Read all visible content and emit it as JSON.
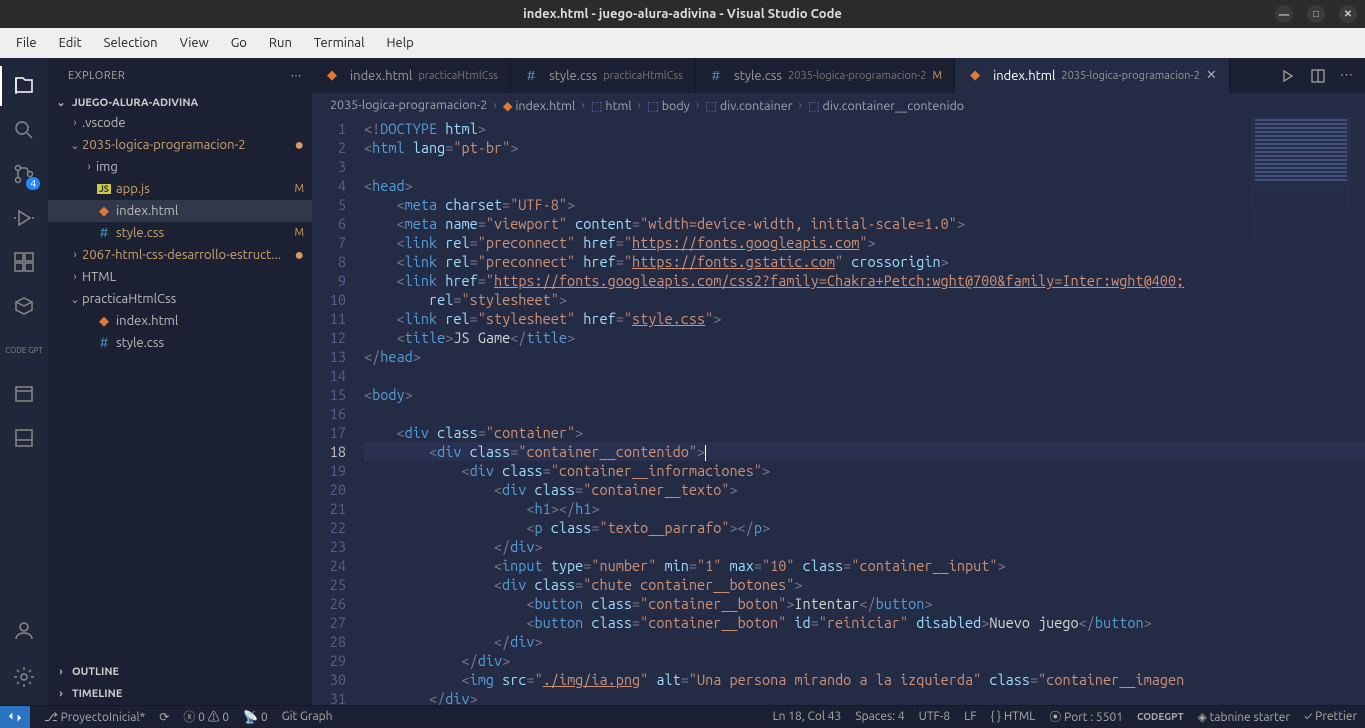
{
  "window": {
    "title": "index.html - juego-alura-adivina - Visual Studio Code"
  },
  "menubar": [
    "File",
    "Edit",
    "Selection",
    "View",
    "Go",
    "Run",
    "Terminal",
    "Help"
  ],
  "activitybar": {
    "scm_badge": "4",
    "codegpt_label": "CODE\nGPT"
  },
  "sidebar": {
    "title": "EXPLORER",
    "project": "JUEGO-ALURA-ADIVINA",
    "tree": [
      {
        "indent": 1,
        "chevron": "›",
        "label": ".vscode",
        "type": "folder"
      },
      {
        "indent": 1,
        "chevron": "⌄",
        "label": "2035-logica-programacion-2",
        "type": "folder",
        "dot": true,
        "color": "modified"
      },
      {
        "indent": 2,
        "chevron": "›",
        "label": "img",
        "type": "folder"
      },
      {
        "indent": 2,
        "icon": "js",
        "label": "app.js",
        "status": "M",
        "color": "modified"
      },
      {
        "indent": 2,
        "icon": "html",
        "label": "index.html",
        "selected": true
      },
      {
        "indent": 2,
        "icon": "css",
        "label": "style.css",
        "status": "M",
        "color": "modified"
      },
      {
        "indent": 1,
        "chevron": "›",
        "label": "2067-html-css-desarrollo-estruct...",
        "type": "folder",
        "dot": true,
        "color": "modified"
      },
      {
        "indent": 1,
        "chevron": "›",
        "label": "HTML",
        "type": "folder"
      },
      {
        "indent": 1,
        "chevron": "⌄",
        "label": "practicaHtmlCss",
        "type": "folder"
      },
      {
        "indent": 2,
        "icon": "html",
        "label": "index.html"
      },
      {
        "indent": 2,
        "icon": "css",
        "label": "style.css"
      }
    ],
    "outline": "OUTLINE",
    "timeline": "TIMELINE"
  },
  "tabs": [
    {
      "icon": "html",
      "name": "index.html",
      "desc": "practicaHtmlCss",
      "active": false
    },
    {
      "icon": "css",
      "name": "style.css",
      "desc": "practicaHtmlCss",
      "active": false
    },
    {
      "icon": "css",
      "name": "style.css",
      "desc": "2035-logica-programacion-2",
      "status": "M",
      "active": false
    },
    {
      "icon": "html",
      "name": "index.html",
      "desc": "2035-logica-programacion-2",
      "active": true,
      "close": true
    }
  ],
  "breadcrumbs": [
    {
      "label": "2035-logica-programacion-2"
    },
    {
      "icon": "html",
      "label": "index.html"
    },
    {
      "icon": "el",
      "label": "html"
    },
    {
      "icon": "el",
      "label": "body"
    },
    {
      "icon": "el",
      "label": "div.container"
    },
    {
      "icon": "el",
      "label": "div.container__contenido"
    }
  ],
  "code_lines": [
    {
      "n": 1,
      "html": "<span class='gray'>&lt;!</span><span class='blue'>DOCTYPE</span> <span class='lblue'>html</span><span class='gray'>&gt;</span>"
    },
    {
      "n": 2,
      "html": "<span class='gray'>&lt;</span><span class='blue'>html</span> <span class='lblue'>lang</span><span class='gray'>=</span><span class='string'>\"pt-br\"</span><span class='gray'>&gt;</span>"
    },
    {
      "n": 3,
      "html": ""
    },
    {
      "n": 4,
      "html": "<span class='gray'>&lt;</span><span class='blue'>head</span><span class='gray'>&gt;</span>"
    },
    {
      "n": 5,
      "html": "    <span class='gray'>&lt;</span><span class='blue'>meta</span> <span class='lblue'>charset</span><span class='gray'>=</span><span class='string'>\"UTF-8\"</span><span class='gray'>&gt;</span>"
    },
    {
      "n": 6,
      "html": "    <span class='gray'>&lt;</span><span class='blue'>meta</span> <span class='lblue'>name</span><span class='gray'>=</span><span class='string'>\"viewport\"</span> <span class='lblue'>content</span><span class='gray'>=</span><span class='string'>\"width=device-width, initial-scale=1.0\"</span><span class='gray'>&gt;</span>"
    },
    {
      "n": 7,
      "html": "    <span class='gray'>&lt;</span><span class='blue'>link</span> <span class='lblue'>rel</span><span class='gray'>=</span><span class='string'>\"preconnect\"</span> <span class='lblue'>href</span><span class='gray'>=</span><span class='string'>\"<span class='underline'>https://fonts.googleapis.com</span>\"</span><span class='gray'>&gt;</span>"
    },
    {
      "n": 8,
      "html": "    <span class='gray'>&lt;</span><span class='blue'>link</span> <span class='lblue'>rel</span><span class='gray'>=</span><span class='string'>\"preconnect\"</span> <span class='lblue'>href</span><span class='gray'>=</span><span class='string'>\"<span class='underline'>https://fonts.gstatic.com</span>\"</span> <span class='lblue'>crossorigin</span><span class='gray'>&gt;</span>"
    },
    {
      "n": 9,
      "html": "    <span class='gray'>&lt;</span><span class='blue'>link</span> <span class='lblue'>href</span><span class='gray'>=</span><span class='string'>\"<span class='underline'>https://fonts.googleapis.com/css2?family=Chakra+Petch:wght@700&amp;family=Inter:wght@400;</span></span>"
    },
    {
      "n": 10,
      "html": "        <span class='lblue'>rel</span><span class='gray'>=</span><span class='string'>\"stylesheet\"</span><span class='gray'>&gt;</span>"
    },
    {
      "n": 11,
      "html": "    <span class='gray'>&lt;</span><span class='blue'>link</span> <span class='lblue'>rel</span><span class='gray'>=</span><span class='string'>\"stylesheet\"</span> <span class='lblue'>href</span><span class='gray'>=</span><span class='string'>\"<span class='underline'>style.css</span>\"</span><span class='gray'>&gt;</span>"
    },
    {
      "n": 12,
      "html": "    <span class='gray'>&lt;</span><span class='blue'>title</span><span class='gray'>&gt;</span>JS Game<span class='gray'>&lt;/</span><span class='blue'>title</span><span class='gray'>&gt;</span>"
    },
    {
      "n": 13,
      "html": "<span class='gray'>&lt;/</span><span class='blue'>head</span><span class='gray'>&gt;</span>"
    },
    {
      "n": 14,
      "html": ""
    },
    {
      "n": 15,
      "html": "<span class='gray'>&lt;</span><span class='blue'>body</span><span class='gray'>&gt;</span>"
    },
    {
      "n": 16,
      "html": ""
    },
    {
      "n": 17,
      "html": "    <span class='gray'>&lt;</span><span class='blue'>div</span> <span class='lblue'>class</span><span class='gray'>=</span><span class='string'>\"container\"</span><span class='gray'>&gt;</span>"
    },
    {
      "n": 18,
      "html": "        <span class='gray'>&lt;</span><span class='blue'>div</span> <span class='lblue'>class</span><span class='gray'>=</span><span class='string'>\"container__contenido\"</span><span class='gray'>&gt;</span><span class='cursor'></span>",
      "current": true
    },
    {
      "n": 19,
      "html": "            <span class='gray'>&lt;</span><span class='blue'>div</span> <span class='lblue'>class</span><span class='gray'>=</span><span class='string'>\"container__informaciones\"</span><span class='gray'>&gt;</span>"
    },
    {
      "n": 20,
      "html": "                <span class='gray'>&lt;</span><span class='blue'>div</span> <span class='lblue'>class</span><span class='gray'>=</span><span class='string'>\"container__texto\"</span><span class='gray'>&gt;</span>"
    },
    {
      "n": 21,
      "html": "                    <span class='gray'>&lt;</span><span class='blue'>h1</span><span class='gray'>&gt;&lt;/</span><span class='blue'>h1</span><span class='gray'>&gt;</span>"
    },
    {
      "n": 22,
      "html": "                    <span class='gray'>&lt;</span><span class='blue'>p</span> <span class='lblue'>class</span><span class='gray'>=</span><span class='string'>\"texto__parrafo\"</span><span class='gray'>&gt;&lt;/</span><span class='blue'>p</span><span class='gray'>&gt;</span>"
    },
    {
      "n": 23,
      "html": "                <span class='gray'>&lt;/</span><span class='blue'>div</span><span class='gray'>&gt;</span>"
    },
    {
      "n": 24,
      "html": "                <span class='gray'>&lt;</span><span class='blue'>input</span> <span class='lblue'>type</span><span class='gray'>=</span><span class='string'>\"number\"</span> <span class='lblue'>min</span><span class='gray'>=</span><span class='string'>\"1\"</span> <span class='lblue'>max</span><span class='gray'>=</span><span class='string'>\"10\"</span> <span class='lblue'>class</span><span class='gray'>=</span><span class='string'>\"container__input\"</span><span class='gray'>&gt;</span>"
    },
    {
      "n": 25,
      "html": "                <span class='gray'>&lt;</span><span class='blue'>div</span> <span class='lblue'>class</span><span class='gray'>=</span><span class='string'>\"chute container__botones\"</span><span class='gray'>&gt;</span>"
    },
    {
      "n": 26,
      "html": "                    <span class='gray'>&lt;</span><span class='blue'>button</span> <span class='lblue'>class</span><span class='gray'>=</span><span class='string'>\"container__boton\"</span><span class='gray'>&gt;</span>Intentar<span class='gray'>&lt;/</span><span class='blue'>button</span><span class='gray'>&gt;</span>"
    },
    {
      "n": 27,
      "html": "                    <span class='gray'>&lt;</span><span class='blue'>button</span> <span class='lblue'>class</span><span class='gray'>=</span><span class='string'>\"container__boton\"</span> <span class='lblue'>id</span><span class='gray'>=</span><span class='string'>\"reiniciar\"</span> <span class='lblue'>disabled</span><span class='gray'>&gt;</span>Nuevo juego<span class='gray'>&lt;/</span><span class='blue'>button</span><span class='gray'>&gt;</span>"
    },
    {
      "n": 28,
      "html": "                <span class='gray'>&lt;/</span><span class='blue'>div</span><span class='gray'>&gt;</span>"
    },
    {
      "n": 29,
      "html": "            <span class='gray'>&lt;/</span><span class='blue'>div</span><span class='gray'>&gt;</span>"
    },
    {
      "n": 30,
      "html": "            <span class='gray'>&lt;</span><span class='blue'>img</span> <span class='lblue'>src</span><span class='gray'>=</span><span class='string'>\"<span class='underline'>./img/ia.png</span>\"</span> <span class='lblue'>alt</span><span class='gray'>=</span><span class='string'>\"Una persona mirando a la izquierda\"</span> <span class='lblue'>class</span><span class='gray'>=</span><span class='string'>\"container__imagen</span>"
    },
    {
      "n": 31,
      "html": "        <span class='gray'>&lt;/</span><span class='blue'>div</span><span class='gray'>&gt;</span>"
    }
  ],
  "statusbar": {
    "branch": "ProyectoInicial*",
    "errors": "0",
    "warnings": "0",
    "signal": "0",
    "gitgraph": "Git Graph",
    "lncol": "Ln 18, Col 43",
    "spaces": "Spaces: 4",
    "encoding": "UTF-8",
    "eol": "LF",
    "lang": "HTML",
    "port": "Port : 5501",
    "tabnine": "tabnine starter",
    "prettier": "Prettier"
  }
}
